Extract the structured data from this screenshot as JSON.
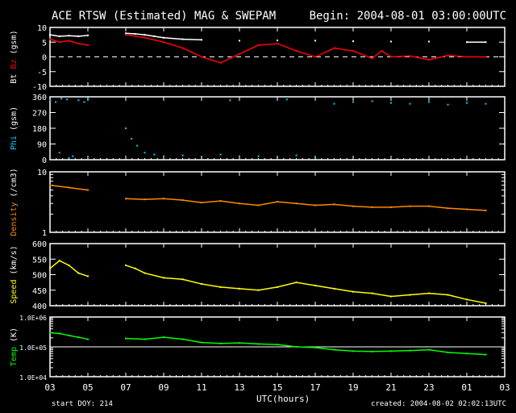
{
  "header": {
    "title": "ACE RTSW (Estimated) MAG & SWEPAM",
    "begin": "Begin: 2004-08-01 03:00:00UTC"
  },
  "footer": {
    "start_doy": "start DOY: 214",
    "created": "created: 2004-08-02 02:02:13UTC",
    "xlabel": "UTC(hours)"
  },
  "chart_data": {
    "type": "line",
    "xlabel": "UTC(hours)",
    "x_ticks": [
      "03",
      "05",
      "07",
      "09",
      "11",
      "13",
      "15",
      "17",
      "19",
      "21",
      "23",
      "01",
      "03"
    ],
    "xlim_hours_from_start": [
      0,
      24
    ],
    "panels": [
      {
        "ylabel_parts": [
          {
            "text": "Bt",
            "color": "#ffffff"
          },
          {
            "text": " Bz",
            "color": "#ff0000"
          },
          {
            "text": " (gsm)",
            "color": "#ffffff"
          }
        ],
        "scale": "linear",
        "ylim": [
          -10,
          10
        ],
        "yticks": [
          "10",
          "5",
          "0",
          "-5",
          "-10"
        ],
        "ytick_values": [
          10,
          5,
          0,
          -5,
          -10
        ],
        "zero_line": "dashed",
        "series": [
          {
            "name": "Bt",
            "color": "#ffffff",
            "x": [
              0,
              0.5,
              1,
              1.5,
              2,
              4,
              4.5,
              5,
              5.5,
              6,
              7,
              8,
              10,
              12,
              14,
              16,
              18,
              20,
              22,
              23
            ],
            "y": [
              7.5,
              7,
              7.2,
              7,
              7.3,
              8,
              7.8,
              7.5,
              7,
              6.5,
              6,
              5.8,
              5.5,
              5.6,
              5.5,
              5.3,
              5.2,
              5.2,
              5,
              5
            ]
          },
          {
            "name": "Bz",
            "color": "#ff0000",
            "x": [
              0,
              0.5,
              1,
              1.5,
              2,
              4,
              5,
              6,
              7,
              8,
              9,
              10,
              11,
              12,
              13,
              14,
              15,
              16,
              17,
              17.5,
              18,
              19,
              20,
              21,
              22,
              23
            ],
            "y": [
              6,
              5,
              5.5,
              4.5,
              4,
              7.5,
              6.5,
              5,
              3,
              0,
              -2,
              1,
              4,
              4.5,
              2,
              0,
              3,
              2,
              -0.5,
              2,
              0,
              0.3,
              -1,
              0.5,
              0,
              0
            ]
          }
        ]
      },
      {
        "ylabel_parts": [
          {
            "text": "Phi",
            "color": "#00ccff"
          },
          {
            "text": " (gsm)",
            "color": "#ffffff"
          }
        ],
        "scale": "linear",
        "ylim": [
          0,
          360
        ],
        "yticks": [
          "360",
          "270",
          "180",
          "90",
          "0"
        ],
        "ytick_values": [
          360,
          270,
          180,
          90,
          0
        ],
        "series": [
          {
            "name": "Phi",
            "color": "#00ccff",
            "mode": "points",
            "x": [
              0,
              0.3,
              0.6,
              0.9,
              1.2,
              1.5,
              1.8,
              2,
              0.5,
              1,
              4,
              4.3,
              4.6,
              5,
              5.5,
              6,
              7,
              8,
              9,
              10,
              11,
              12,
              13,
              14,
              9.5,
              12.5,
              15,
              16,
              17,
              18,
              19,
              20,
              21,
              22,
              23
            ],
            "y": [
              340,
              330,
              350,
              345,
              20,
              340,
              330,
              345,
              40,
              10,
              180,
              120,
              80,
              40,
              30,
              20,
              25,
              15,
              30,
              20,
              20,
              15,
              25,
              10,
              340,
              345,
              320,
              330,
              335,
              325,
              320,
              330,
              315,
              325,
              320
            ]
          }
        ]
      },
      {
        "ylabel_parts": [
          {
            "text": "Density",
            "color": "#ff8800"
          },
          {
            "text": " (/cm3)",
            "color": "#ffffff"
          }
        ],
        "scale": "log",
        "ylim": [
          1,
          10
        ],
        "yticks": [
          "10",
          "1"
        ],
        "ytick_values": [
          10,
          1
        ],
        "series": [
          {
            "name": "Density",
            "color": "#ff8800",
            "x": [
              0,
              1,
              2,
              4,
              5,
              6,
              7,
              8,
              9,
              10,
              11,
              12,
              13,
              14,
              15,
              16,
              17,
              18,
              19,
              20,
              21,
              22,
              23
            ],
            "y": [
              6,
              5.5,
              5,
              3.6,
              3.5,
              3.6,
              3.4,
              3.1,
              3.3,
              3,
              2.8,
              3.2,
              3,
              2.8,
              2.9,
              2.7,
              2.6,
              2.6,
              2.7,
              2.7,
              2.5,
              2.4,
              2.3
            ]
          }
        ]
      },
      {
        "ylabel_parts": [
          {
            "text": "Speed",
            "color": "#ffff00"
          },
          {
            "text": " (km/s)",
            "color": "#ffffff"
          }
        ],
        "scale": "linear",
        "ylim": [
          400,
          600
        ],
        "yticks": [
          "600",
          "550",
          "500",
          "450",
          "400"
        ],
        "ytick_values": [
          600,
          550,
          500,
          450,
          400
        ],
        "series": [
          {
            "name": "Speed",
            "color": "#ffff00",
            "x": [
              0,
              0.5,
              1,
              1.5,
              2,
              4,
              4.5,
              5,
              6,
              7,
              8,
              9,
              10,
              11,
              12,
              13,
              14,
              15,
              16,
              17,
              18,
              19,
              20,
              21,
              22,
              23
            ],
            "y": [
              520,
              545,
              530,
              505,
              495,
              530,
              520,
              505,
              490,
              485,
              470,
              460,
              455,
              450,
              460,
              475,
              465,
              455,
              445,
              440,
              430,
              435,
              440,
              435,
              420,
              408
            ]
          }
        ]
      },
      {
        "ylabel_parts": [
          {
            "text": "Temp",
            "color": "#00ff00"
          },
          {
            "text": " (K)",
            "color": "#ffffff"
          }
        ],
        "scale": "log",
        "ylim": [
          10000,
          1000000
        ],
        "yticks": [
          "1.0E+06",
          "1.0E+05",
          "1.0E+04"
        ],
        "ytick_values": [
          1000000,
          100000,
          10000
        ],
        "ref_line": 100000,
        "series": [
          {
            "name": "Temp",
            "color": "#00ff00",
            "x": [
              0,
              0.5,
              1,
              1.5,
              2,
              4,
              5,
              6,
              7,
              8,
              9,
              10,
              11,
              12,
              13,
              14,
              15,
              16,
              17,
              18,
              19,
              20,
              21,
              22,
              23
            ],
            "y": [
              300000,
              280000,
              240000,
              210000,
              180000,
              190000,
              180000,
              210000,
              180000,
              140000,
              130000,
              135000,
              125000,
              120000,
              100000,
              95000,
              80000,
              72000,
              70000,
              72000,
              75000,
              80000,
              65000,
              60000,
              55000
            ]
          }
        ]
      }
    ]
  }
}
